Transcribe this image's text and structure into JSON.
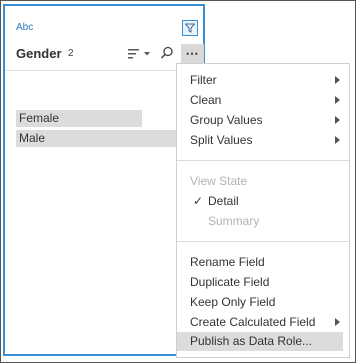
{
  "field": {
    "type_label": "Abc",
    "name": "Gender",
    "count": "2",
    "values": [
      "Female",
      "Male"
    ]
  },
  "icons": {
    "filter": "filter-icon",
    "sort": "sort-icon",
    "search": "search-icon",
    "more": "more-icon"
  },
  "menu": {
    "more_glyph": "⋯",
    "filter": "Filter",
    "clean": "Clean",
    "group_values": "Group Values",
    "split_values": "Split Values",
    "view_state": "View State",
    "detail": "Detail",
    "detail_check": "✓",
    "summary": "Summary",
    "rename_field": "Rename Field",
    "duplicate_field": "Duplicate Field",
    "keep_only_field": "Keep Only Field",
    "create_calculated_field": "Create Calculated Field",
    "publish_as_data_role": "Publish as Data Role..."
  },
  "colors": {
    "accent": "#3a8fd0",
    "highlight": "#dcdcdc",
    "disabled_text": "#b3b3b3"
  }
}
